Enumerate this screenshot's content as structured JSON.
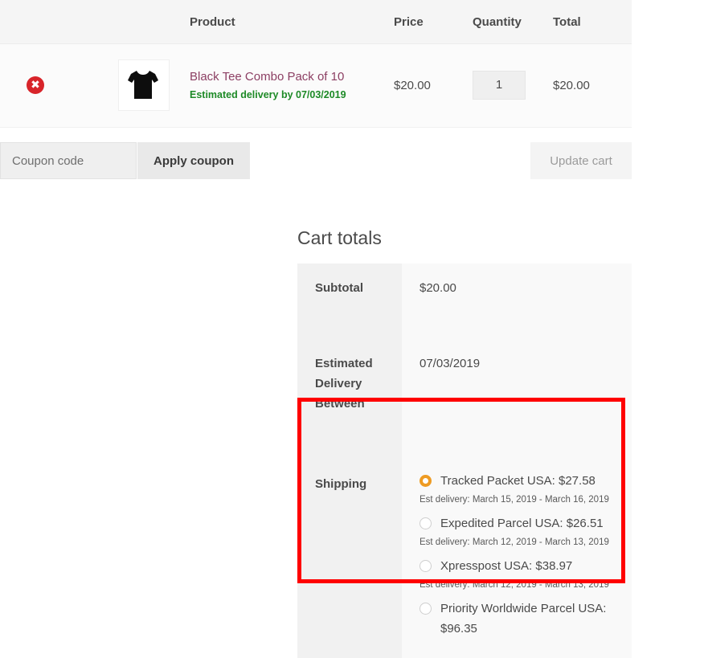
{
  "cart_table": {
    "columns": [
      {
        "key": "remove",
        "label": ""
      },
      {
        "key": "thumb",
        "label": ""
      },
      {
        "key": "product",
        "label": "Product"
      },
      {
        "key": "price",
        "label": "Price"
      },
      {
        "key": "quantity",
        "label": "Quantity"
      },
      {
        "key": "total",
        "label": "Total"
      }
    ],
    "rows": [
      {
        "remove_icon": "remove-item-icon",
        "remove_glyph": "✖",
        "thumbnail": "black-tshirt-thumbnail",
        "product_name": "Black Tee Combo Pack of 10",
        "product_eta": "Estimated delivery by 07/03/2019",
        "price": "$20.00",
        "quantity": "1",
        "total": "$20.00"
      }
    ]
  },
  "coupon": {
    "placeholder": "Coupon code",
    "value": "",
    "apply_label": "Apply coupon",
    "update_cart_label": "Update cart"
  },
  "cart_totals": {
    "title": "Cart totals",
    "subtotal_label": "Subtotal",
    "subtotal_value": "$20.00",
    "eta_label": "Estimated Delivery Between",
    "eta_value": "07/03/2019",
    "shipping_label": "Shipping",
    "shipping_options": [
      {
        "label": "Tracked Packet USA: $27.58",
        "eta": "Est delivery: March 15, 2019 - March 16, 2019",
        "selected": true
      },
      {
        "label": "Expedited Parcel USA: $26.51",
        "eta": "Est delivery: March 12, 2019 - March 13, 2019",
        "selected": false
      },
      {
        "label": "Xpresspost USA: $38.97",
        "eta": "Est delivery: March 12, 2019 - March 13, 2019",
        "selected": false
      },
      {
        "label": "Priority Worldwide Parcel USA: $96.35",
        "eta": "",
        "selected": false
      }
    ]
  },
  "colors": {
    "accent_radio": "#ee9b23",
    "remove_button": "#d8242a",
    "product_link": "#8c3f63",
    "eta_green": "#1d8a26",
    "highlight_box": "#ff0000"
  }
}
